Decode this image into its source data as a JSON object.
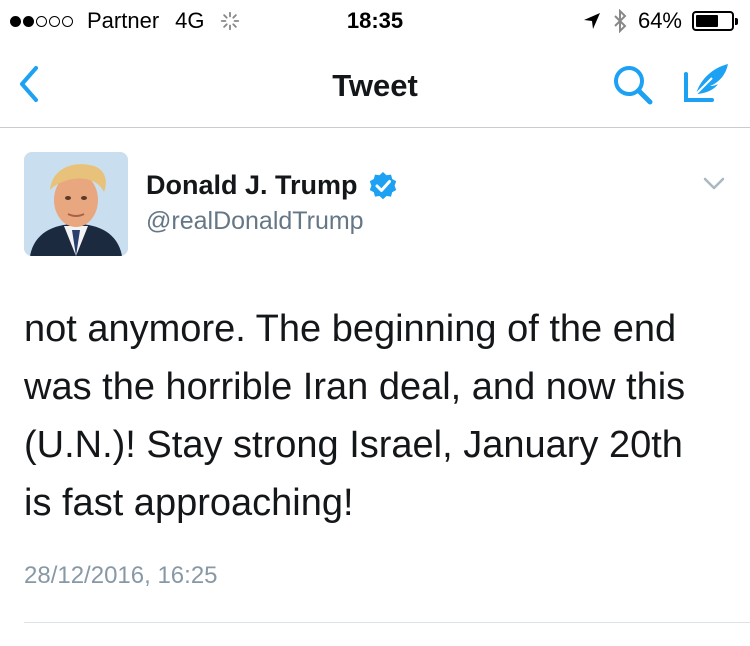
{
  "status_bar": {
    "carrier": "Partner",
    "network": "4G",
    "time": "18:35",
    "battery_percent": "64%",
    "battery_level": 0.64,
    "signal_filled": 2,
    "signal_total": 5
  },
  "nav": {
    "title": "Tweet",
    "icons": [
      "back-chevron-icon",
      "search-icon",
      "compose-icon"
    ],
    "accent_color": "#1da1f2"
  },
  "tweet": {
    "display_name": "Donald J. Trump",
    "username": "@realDonaldTrump",
    "verified": true,
    "text": "not anymore. The beginning of the end\nwas the horrible Iran deal, and now this\n(U.N.)! Stay strong Israel, January 20th\nis fast approaching!",
    "timestamp": "28/12/2016, 16:25"
  }
}
